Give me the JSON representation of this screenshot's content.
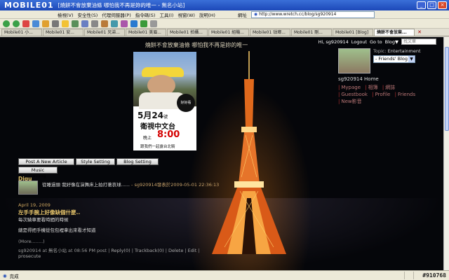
{
  "window": {
    "watermark": "MOBILE01",
    "title": "[燒餅不會放棄油條 哪怕我不再是妳的唯一 - 無名小站]"
  },
  "menubar": {
    "items": [
      "檢視(V)",
      "安全性(S)",
      "代理伺服器(P)",
      "指令碼(S)",
      "工具(I)",
      "視窗(W)",
      "說明(H)"
    ],
    "address_label": "網址",
    "address_value": "http://www.wretch.cc/blog/sg920914"
  },
  "tabs": [
    {
      "label": "Mobile01 小..."
    },
    {
      "label": "Mobile01 安..."
    },
    {
      "label": "Mobile01 兄弟..."
    },
    {
      "label": "Mobile01 美眉..."
    },
    {
      "label": "Mobile01 拍攝..."
    },
    {
      "label": "Mobile01 組機..."
    },
    {
      "label": "Mobile01 琺瑯..."
    },
    {
      "label": "Mobile01 剛..."
    },
    {
      "label": "Mobile01 [Blog]"
    },
    {
      "label": "燒餅不會放棄..."
    }
  ],
  "page": {
    "site_title": "燒餅不會放棄油條 哪怕我不再是妳的唯一",
    "hi_user": "Hi, sg920914",
    "logout": "Logout",
    "goto": "Go to",
    "blog_menu": "Blog▼",
    "search_placeholder": "找文章",
    "banner": {
      "logo": "好好看",
      "date_num": "5月24",
      "date_suffix": "號",
      "channel": "衛視中文台",
      "evening": "晚上",
      "time": "8:00",
      "slogan": "跟我們一起露台北騎"
    },
    "profile": {
      "topic_label": "Topic:",
      "topic_value": "Entertainment",
      "friends_select": "- Friends' Blog -",
      "home": "sg920914 Home",
      "links_row1": [
        "Mypage",
        "相簿",
        "網誌"
      ],
      "links_row2": [
        "Guestbook",
        "Profile",
        "Friends"
      ],
      "links_row3": [
        "New影音"
      ]
    },
    "buttons": {
      "post": "Post A New Article",
      "style": "Style Setting",
      "blog": "Blog Setting",
      "music": "Music Setting"
    },
    "blog_name": "Digu",
    "comment": {
      "text": "從睡過頭 我好像在演舞床上拍打著哀球......",
      "who": "- sg920914發表於2009-05-01 22:36:13"
    },
    "post": {
      "date": "April 19, 2009",
      "title": "左手手腕上好像缺個什麼..",
      "body1": "每次騎車要看時間的時候",
      "body2": "總是得把手機從包包裡拿出來看才知道",
      "more": "(More........)",
      "meta_prefix": "sg920914 at 無名小站 at 08:56 PM post",
      "reply": "Reply(0)",
      "trackback": "Trackback(0)",
      "delete": "Delete",
      "edit": "Edit",
      "category": "prosecute"
    }
  },
  "status": {
    "done": "完成",
    "watermark": "#910768"
  }
}
